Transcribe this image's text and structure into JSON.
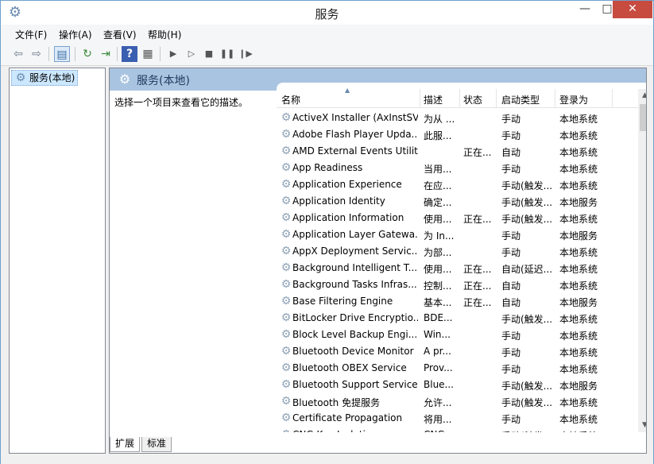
{
  "window": {
    "title": "服务",
    "minimize": "—",
    "maximize": "□",
    "close": "✕"
  },
  "menu": {
    "items": [
      {
        "label": "文件(F)"
      },
      {
        "label": "操作(A)"
      },
      {
        "label": "查看(V)"
      },
      {
        "label": "帮助(H)"
      }
    ]
  },
  "toolbar": {
    "icons": [
      "back-icon",
      "forward-icon",
      "show-hide-tree-icon",
      "refresh-icon",
      "export-icon",
      "help-icon",
      "properties-icon",
      "start-icon",
      "start-alt-icon",
      "stop-icon",
      "pause-icon",
      "restart-icon"
    ]
  },
  "tree": {
    "selected_label": "服务(本地)"
  },
  "pane": {
    "header_title": "服务(本地)",
    "description_prompt": "选择一个项目来查看它的描述。"
  },
  "list": {
    "columns": [
      "名称",
      "描述",
      "状态",
      "启动类型",
      "登录为"
    ],
    "rows": [
      {
        "name": "ActiveX Installer (AxInstSV)",
        "desc": "为从 ...",
        "status": "",
        "startup": "手动",
        "logon": "本地系统"
      },
      {
        "name": "Adobe Flash Player Upda...",
        "desc": "此服...",
        "status": "",
        "startup": "手动",
        "logon": "本地系统"
      },
      {
        "name": "AMD External Events Utility",
        "desc": "",
        "status": "正在...",
        "startup": "自动",
        "logon": "本地系统"
      },
      {
        "name": "App Readiness",
        "desc": "当用...",
        "status": "",
        "startup": "手动",
        "logon": "本地系统"
      },
      {
        "name": "Application Experience",
        "desc": "在应...",
        "status": "",
        "startup": "手动(触发...",
        "logon": "本地系统"
      },
      {
        "name": "Application Identity",
        "desc": "确定...",
        "status": "",
        "startup": "手动(触发...",
        "logon": "本地服务"
      },
      {
        "name": "Application Information",
        "desc": "使用...",
        "status": "正在...",
        "startup": "手动(触发...",
        "logon": "本地系统"
      },
      {
        "name": "Application Layer Gatewa...",
        "desc": "为 In...",
        "status": "",
        "startup": "手动",
        "logon": "本地服务"
      },
      {
        "name": "AppX Deployment Servic...",
        "desc": "为部...",
        "status": "",
        "startup": "手动",
        "logon": "本地系统"
      },
      {
        "name": "Background Intelligent T...",
        "desc": "使用...",
        "status": "正在...",
        "startup": "自动(延迟...",
        "logon": "本地系统"
      },
      {
        "name": "Background Tasks Infras...",
        "desc": "控制...",
        "status": "正在...",
        "startup": "自动",
        "logon": "本地系统"
      },
      {
        "name": "Base Filtering Engine",
        "desc": "基本...",
        "status": "正在...",
        "startup": "自动",
        "logon": "本地服务"
      },
      {
        "name": "BitLocker Drive Encryptio...",
        "desc": "BDE...",
        "status": "",
        "startup": "手动(触发...",
        "logon": "本地系统"
      },
      {
        "name": "Block Level Backup Engi...",
        "desc": "Win...",
        "status": "",
        "startup": "手动",
        "logon": "本地系统"
      },
      {
        "name": "Bluetooth Device Monitor",
        "desc": "A pr...",
        "status": "",
        "startup": "手动",
        "logon": "本地系统"
      },
      {
        "name": "Bluetooth OBEX Service",
        "desc": "Prov...",
        "status": "",
        "startup": "手动",
        "logon": "本地系统"
      },
      {
        "name": "Bluetooth Support Service",
        "desc": "Blue...",
        "status": "",
        "startup": "手动(触发...",
        "logon": "本地服务"
      },
      {
        "name": "Bluetooth 免提服务",
        "desc": "允许...",
        "status": "",
        "startup": "手动(触发...",
        "logon": "本地系统"
      },
      {
        "name": "Certificate Propagation",
        "desc": "将用...",
        "status": "",
        "startup": "手动",
        "logon": "本地系统"
      },
      {
        "name": "CNG Key Isolation",
        "desc": "CNG...",
        "status": "",
        "startup": "手动(触发...",
        "logon": "本地系统"
      }
    ]
  },
  "tabs": [
    {
      "label": "扩展"
    },
    {
      "label": "标准"
    }
  ],
  "colors": {
    "header_bg": "#a9c4e0",
    "selected_bg": "#cce8ff",
    "close_button": "#c74b3f"
  }
}
